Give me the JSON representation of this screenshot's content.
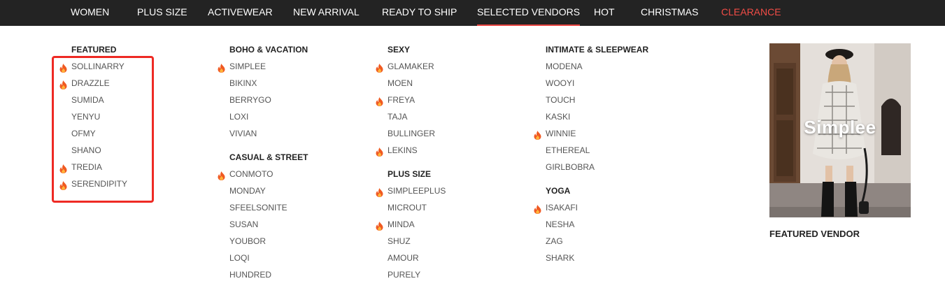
{
  "nav": {
    "items": [
      {
        "label": "WOMEN"
      },
      {
        "label": "PLUS SIZE"
      },
      {
        "label": "ACTIVEWEAR"
      },
      {
        "label": "NEW ARRIVAL"
      },
      {
        "label": "READY TO SHIP"
      },
      {
        "label": "SELECTED VENDORS",
        "active": true
      },
      {
        "label": "HOT"
      },
      {
        "label": "CHRISTMAS"
      },
      {
        "label": "CLEARANCE",
        "color": "#f04c46"
      }
    ]
  },
  "menu": {
    "featured": {
      "heading": "FEATURED",
      "items": [
        {
          "label": "SOLLINARRY",
          "hot": true
        },
        {
          "label": "DRAZZLE",
          "hot": true
        },
        {
          "label": "SUMIDA",
          "hot": false
        },
        {
          "label": "YENYU",
          "hot": false
        },
        {
          "label": "OFMY",
          "hot": false
        },
        {
          "label": "SHANO",
          "hot": false
        },
        {
          "label": "TREDIA",
          "hot": true
        },
        {
          "label": "SERENDIPITY",
          "hot": true
        }
      ]
    },
    "boho_vacation": {
      "heading": "BOHO & VACATION",
      "items": [
        {
          "label": "SIMPLEE",
          "hot": true
        },
        {
          "label": "BIKINX",
          "hot": false
        },
        {
          "label": "BERRYGO",
          "hot": false
        },
        {
          "label": "LOXI",
          "hot": false
        },
        {
          "label": "VIVIAN",
          "hot": false
        }
      ]
    },
    "casual_street": {
      "heading": "CASUAL & STREET",
      "items": [
        {
          "label": "CONMOTO",
          "hot": true
        },
        {
          "label": "MONDAY",
          "hot": false
        },
        {
          "label": "SFEELSONITE",
          "hot": false
        },
        {
          "label": "SUSAN",
          "hot": false
        },
        {
          "label": "YOUBOR",
          "hot": false
        },
        {
          "label": "LOQI",
          "hot": false
        },
        {
          "label": "HUNDRED",
          "hot": false
        }
      ]
    },
    "sexy": {
      "heading": "SEXY",
      "items": [
        {
          "label": "GLAMAKER",
          "hot": true
        },
        {
          "label": "MOEN",
          "hot": false
        },
        {
          "label": "FREYA",
          "hot": true
        },
        {
          "label": "TAJA",
          "hot": false
        },
        {
          "label": "BULLINGER",
          "hot": false
        },
        {
          "label": "LEKINS",
          "hot": true
        }
      ]
    },
    "plus_size": {
      "heading": "PLUS SIZE",
      "items": [
        {
          "label": "SIMPLEEPLUS",
          "hot": true
        },
        {
          "label": "MICROUT",
          "hot": false
        },
        {
          "label": "MINDA",
          "hot": true
        },
        {
          "label": "SHUZ",
          "hot": false
        },
        {
          "label": "AMOUR",
          "hot": false
        },
        {
          "label": "PURELY",
          "hot": false
        }
      ]
    },
    "intimate_sleepwear": {
      "heading": "INTIMATE & SLEEPWEAR",
      "items": [
        {
          "label": "MODENA",
          "hot": false
        },
        {
          "label": "WOOYI",
          "hot": false
        },
        {
          "label": "TOUCH",
          "hot": false
        },
        {
          "label": "KASKI",
          "hot": false
        },
        {
          "label": "WINNIE",
          "hot": true
        },
        {
          "label": "ETHEREAL",
          "hot": false
        },
        {
          "label": "GIRLBOBRA",
          "hot": false
        }
      ]
    },
    "yoga": {
      "heading": "YOGA",
      "items": [
        {
          "label": "ISAKAFI",
          "hot": true
        },
        {
          "label": "NESHA",
          "hot": false
        },
        {
          "label": "ZAG",
          "hot": false
        },
        {
          "label": "SHARK",
          "hot": false
        }
      ]
    }
  },
  "featured_vendor": {
    "image_text": "Simplee",
    "caption": "FEATURED VENDOR"
  },
  "colors": {
    "nav_bg": "#232323",
    "accent": "#e8423f",
    "highlight_box": "#ee2a24",
    "hot_icon": "#f05a22"
  },
  "icons": {
    "hot": "fire-icon"
  }
}
